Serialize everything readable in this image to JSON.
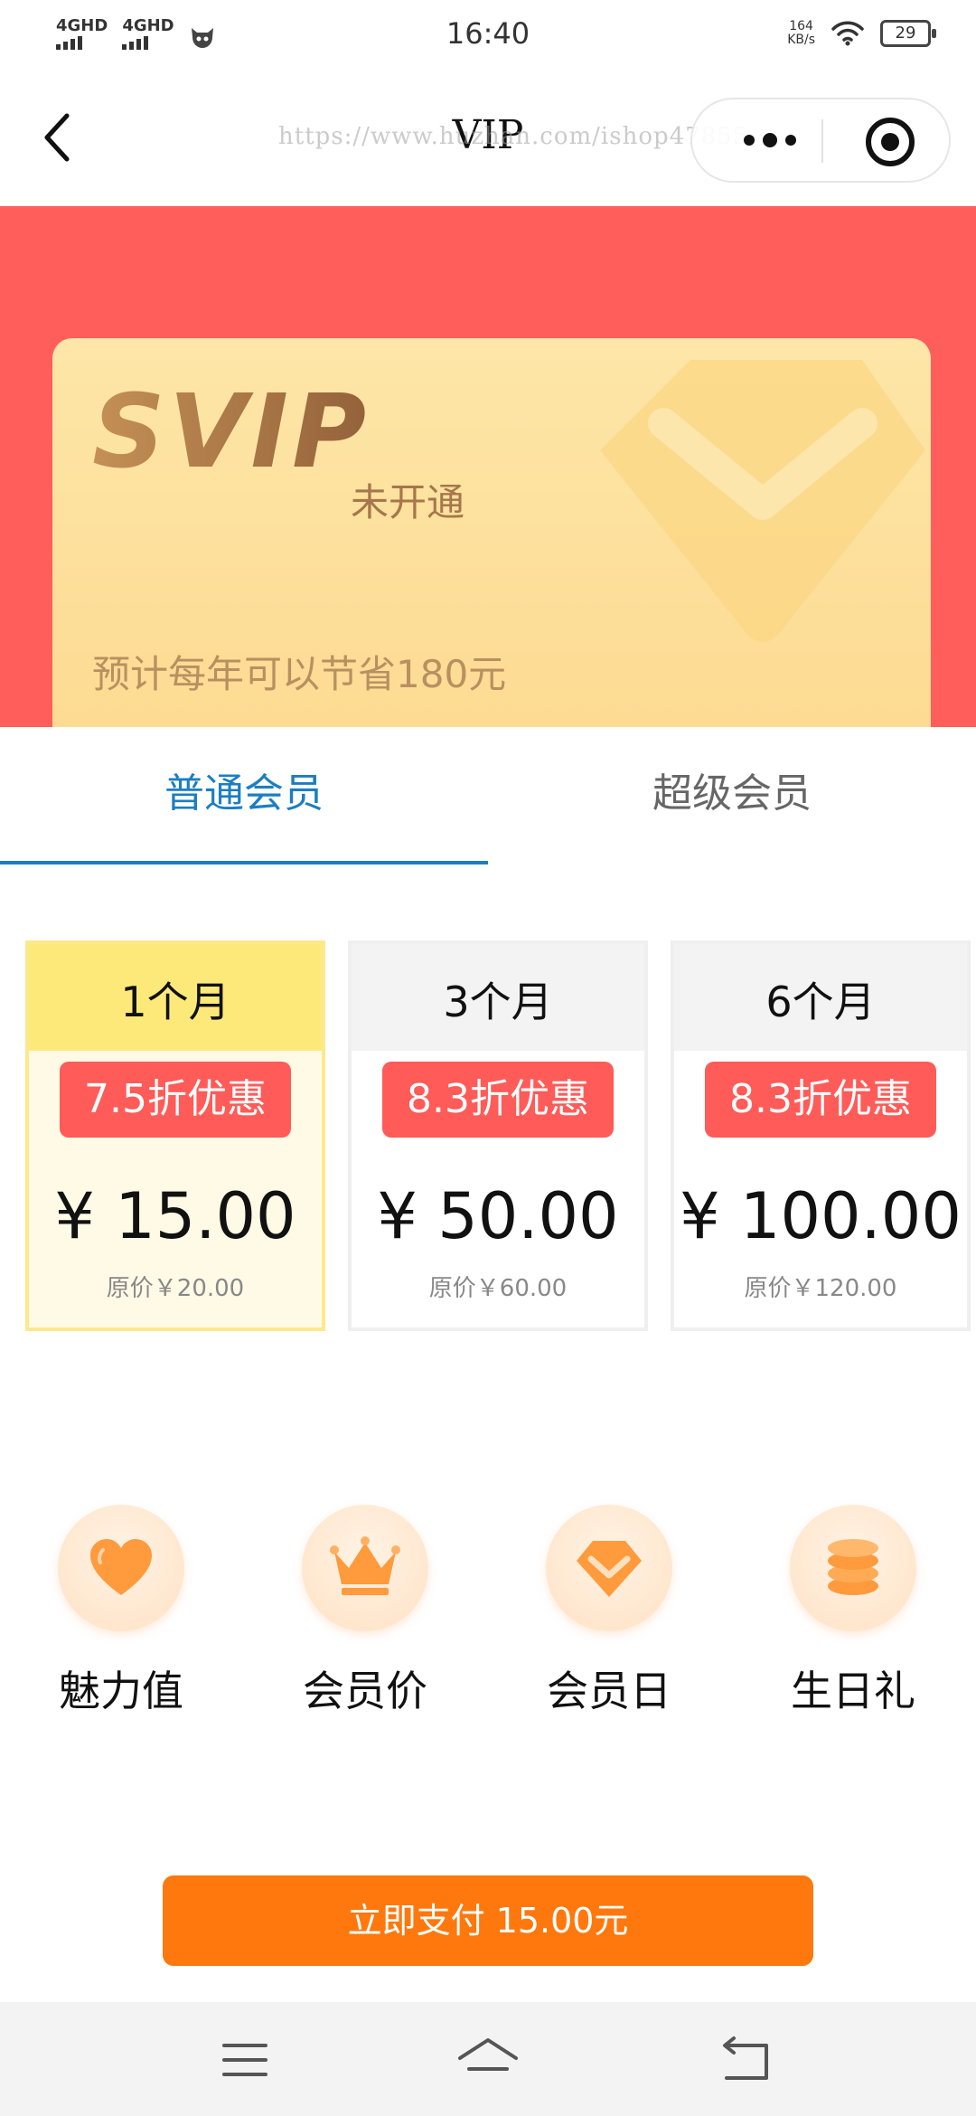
{
  "status_bar": {
    "signal_1": "4GHD",
    "signal_2": "4GHD",
    "time": "16:40",
    "net_speed_value": "164",
    "net_speed_unit": "KB/s",
    "battery": "29"
  },
  "nav": {
    "title": "VIP",
    "watermark": "https://www.huzhan.com/ishop47855"
  },
  "card": {
    "logo_text": "SVIP",
    "status": "未开通",
    "savings": "预计每年可以节省180元",
    "colors": {
      "hero_bg": "#ff5e5a",
      "card_bg": "#fddf9a",
      "logo": "#a8733f"
    }
  },
  "tabs": [
    {
      "label": "普通会员",
      "active": true
    },
    {
      "label": "超级会员",
      "active": false
    }
  ],
  "plans": [
    {
      "duration": "1个月",
      "discount": "7.5折优惠",
      "price": "¥ 15.00",
      "original": "原价￥20.00",
      "selected": true
    },
    {
      "duration": "3个月",
      "discount": "8.3折优惠",
      "price": "¥ 50.00",
      "original": "原价￥60.00",
      "selected": false
    },
    {
      "duration": "6个月",
      "discount": "8.3折优惠",
      "price": "¥ 100.00",
      "original": "原价￥120.00",
      "selected": false
    }
  ],
  "benefits": [
    {
      "label": "魅力值",
      "icon": "heart-icon"
    },
    {
      "label": "会员价",
      "icon": "crown-icon"
    },
    {
      "label": "会员日",
      "icon": "diamond-icon"
    },
    {
      "label": "生日礼",
      "icon": "coins-icon"
    }
  ],
  "pay_button": {
    "label": "立即支付 15.00元",
    "color": "#ff780e"
  },
  "accent_colors": {
    "tab_active": "#1b7ec2",
    "badge": "#ff5b58",
    "selected_plan_head": "#fde97a"
  }
}
